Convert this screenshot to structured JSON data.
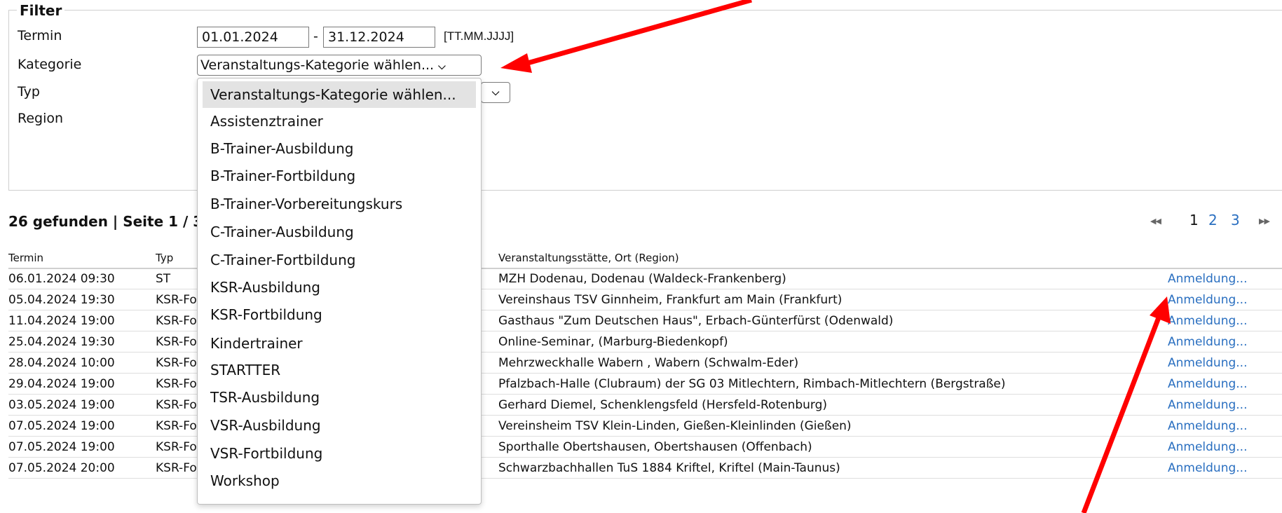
{
  "filter": {
    "legend": "Filter",
    "labels": {
      "termin": "Termin",
      "kategorie": "Kategorie",
      "typ": "Typ",
      "region": "Region"
    },
    "date_from": "01.01.2024",
    "date_sep": "-",
    "date_to": "31.12.2024",
    "date_hint": "[TT.MM.JJJJ]",
    "kategorie_selected": "Veranstaltungs-Kategorie wählen...",
    "kategorie_options": [
      "Veranstaltungs-Kategorie wählen...",
      "Assistenztrainer",
      "B-Trainer-Ausbildung",
      "B-Trainer-Fortbildung",
      "B-Trainer-Vorbereitungskurs",
      "C-Trainer-Ausbildung",
      "C-Trainer-Fortbildung",
      "KSR-Ausbildung",
      "KSR-Fortbildung",
      "Kindertrainer",
      "STARTTER",
      "TSR-Ausbildung",
      "VSR-Ausbildung",
      "VSR-Fortbildung",
      "Workshop"
    ]
  },
  "results": {
    "count_text": "26 gefunden | Seite 1 / 3",
    "pager": {
      "pages": [
        "1",
        "2",
        "3"
      ],
      "current": "1"
    },
    "columns": {
      "termin": "Termin",
      "typ": "Typ",
      "venue": "Veranstaltungsstätte, Ort (Region)"
    },
    "rows": [
      {
        "termin": "06.01.2024 09:30",
        "typ": "ST",
        "venue": "MZH Dodenau, Dodenau (Waldeck-Frankenberg)",
        "action": "Anmeldung..."
      },
      {
        "termin": "05.04.2024 19:30",
        "typ": "KSR-Fortbildung",
        "venue": "Vereinshaus TSV Ginnheim, Frankfurt am Main (Frankfurt)",
        "action": "Anmeldung..."
      },
      {
        "termin": "11.04.2024 19:00",
        "typ": "KSR-Fortbildung",
        "venue": "Gasthaus \"Zum Deutschen Haus\", Erbach-Günterfürst (Odenwald)",
        "action": "Anmeldung..."
      },
      {
        "termin": "25.04.2024 19:30",
        "typ": "KSR-Fortbildung",
        "venue": "Online-Seminar, (Marburg-Biedenkopf)",
        "action": "Anmeldung..."
      },
      {
        "termin": "28.04.2024 10:00",
        "typ": "KSR-Fortbildung",
        "venue": "Mehrzweckhalle Wabern , Wabern (Schwalm-Eder)",
        "action": "Anmeldung..."
      },
      {
        "termin": "29.04.2024 19:00",
        "typ": "KSR-Fortbildung",
        "venue": "Pfalzbach-Halle (Clubraum) der SG 03 Mitlechtern, Rimbach-Mitlechtern (Bergstraße)",
        "action": "Anmeldung..."
      },
      {
        "termin": "03.05.2024 19:00",
        "typ": "KSR-Fortbildung",
        "venue": "Gerhard Diemel, Schenklengsfeld (Hersfeld-Rotenburg)",
        "action": "Anmeldung..."
      },
      {
        "termin": "07.05.2024 19:00",
        "typ": "KSR-Fortbildung",
        "venue": "Vereinsheim TSV Klein-Linden, Gießen-Kleinlinden (Gießen)",
        "action": "Anmeldung..."
      },
      {
        "termin": "07.05.2024 19:00",
        "typ": "KSR-Fortbildung",
        "venue": "Sporthalle Obertshausen, Obertshausen (Offenbach)",
        "action": "Anmeldung..."
      },
      {
        "termin": "07.05.2024 20:00",
        "typ": "KSR-Fortbildung",
        "venue": "Schwarzbachhallen TuS 1884 Kriftel, Kriftel (Main-Taunus)",
        "action": "Anmeldung..."
      }
    ]
  },
  "colors": {
    "link": "#2a6fc0",
    "arrow": "#ff0000",
    "selected_option": "#e3e3e3"
  }
}
